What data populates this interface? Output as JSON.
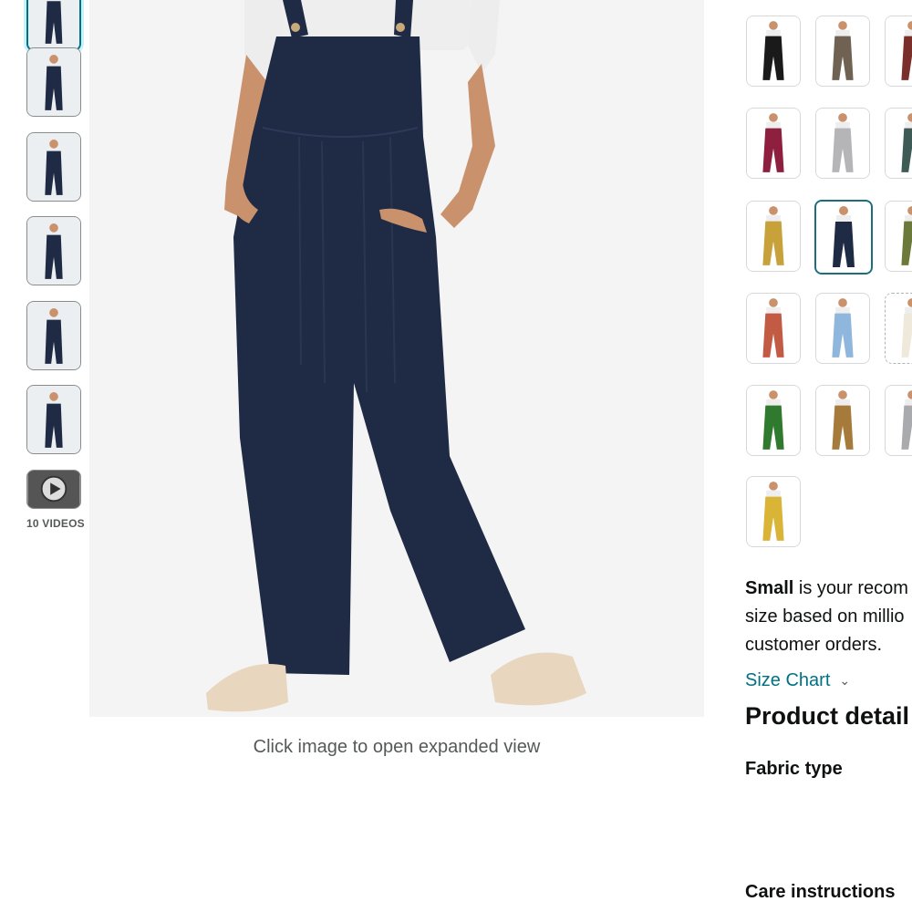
{
  "gallery": {
    "thumbnails": [
      {
        "name": "front-view-navy"
      },
      {
        "name": "full-body-navy"
      },
      {
        "name": "back-view-navy"
      },
      {
        "name": "sitting-pose-navy"
      },
      {
        "name": "outdoor-bench-navy"
      },
      {
        "name": "closeup-navy"
      },
      {
        "name": "video-thumbnail",
        "icon": "play-icon"
      }
    ],
    "videos_label": "10 VIDEOS",
    "expand_hint": "Click image to open expanded view"
  },
  "colors": {
    "accent": "#007185",
    "selected_border": "#1c6e7d",
    "product_navy": "#1f2a44",
    "swatches": [
      {
        "color": "#1a1a1a"
      },
      {
        "color": "#6f6252"
      },
      {
        "color": "#7a2f2a"
      },
      {
        "color": "#8e1f3e"
      },
      {
        "color": "#b5b5b8"
      },
      {
        "color": "#3e5b55"
      },
      {
        "color": "#c9a13a"
      },
      {
        "color": "#1f2a44",
        "selected": true
      },
      {
        "color": "#6b7a3a"
      },
      {
        "color": "#c25a44"
      },
      {
        "color": "#8fb6dc"
      },
      {
        "color": "#efe9dc"
      },
      {
        "color": "#2f7a2f"
      },
      {
        "color": "#a67a3a"
      },
      {
        "color": "#a9aaad"
      },
      {
        "color": "#d9b436"
      }
    ]
  },
  "recommendation": {
    "size": "Small",
    "line1_rest": " is your recom",
    "line2": "size based on millio",
    "line3": "customer orders."
  },
  "size_chart": {
    "label": "Size Chart",
    "icon": "chevron-down-icon"
  },
  "product_details": {
    "title": "Product detail",
    "fabric_label": "Fabric type",
    "care_label": "Care instructions"
  }
}
